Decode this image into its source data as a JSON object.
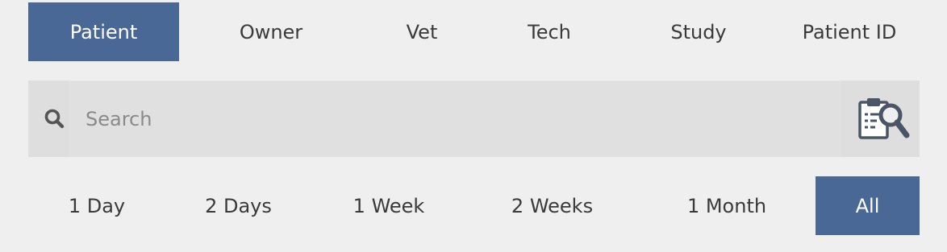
{
  "colors": {
    "accent": "#4a6895",
    "background": "#efefef",
    "search_bar": "#dedede"
  },
  "tabs": [
    {
      "label": "Patient",
      "active": true
    },
    {
      "label": "Owner",
      "active": false
    },
    {
      "label": "Vet",
      "active": false
    },
    {
      "label": "Tech",
      "active": false
    },
    {
      "label": "Study",
      "active": false
    },
    {
      "label": "Patient ID",
      "active": false
    }
  ],
  "search": {
    "placeholder": "Search",
    "value": "",
    "icon": "search-icon",
    "advanced_icon": "clipboard-search-icon"
  },
  "ranges": [
    {
      "label": "1 Day",
      "active": false
    },
    {
      "label": "2 Days",
      "active": false
    },
    {
      "label": "1 Week",
      "active": false
    },
    {
      "label": "2 Weeks",
      "active": false
    },
    {
      "label": "1 Month",
      "active": false
    },
    {
      "label": "All",
      "active": true
    }
  ]
}
